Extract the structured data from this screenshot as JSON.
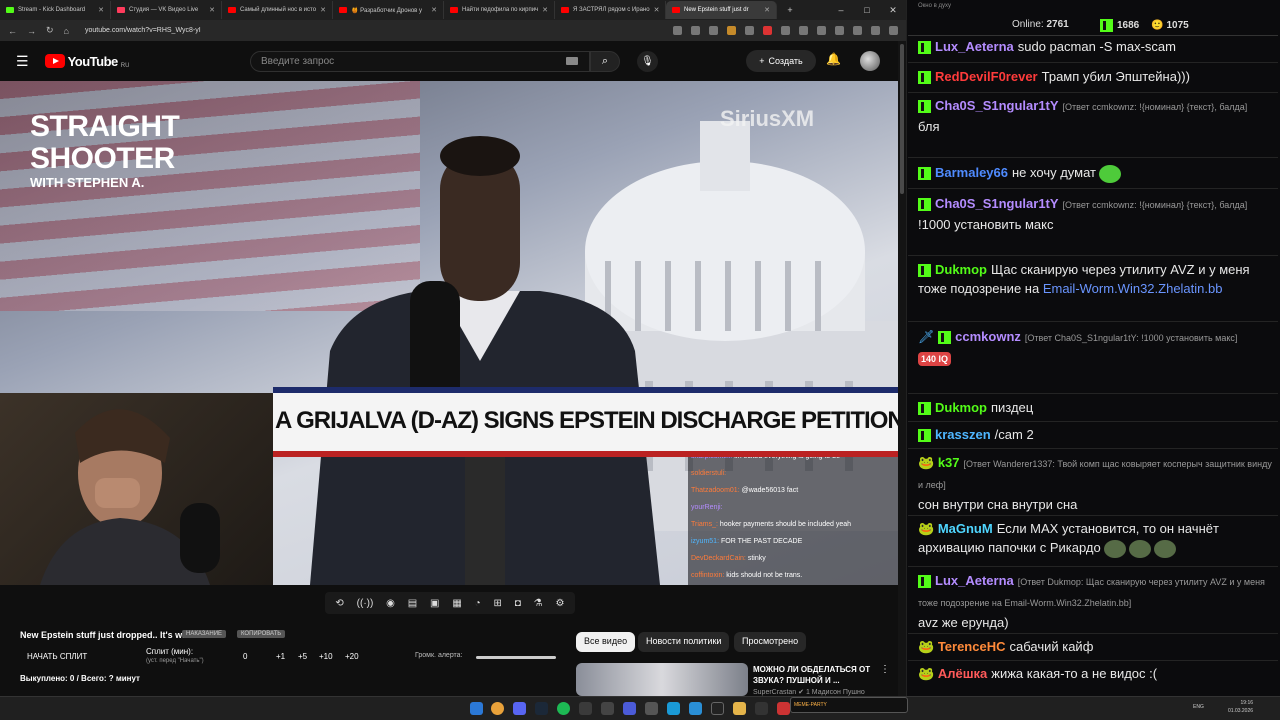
{
  "browser": {
    "tabs": [
      {
        "title": "Stream - Kick Dashboard",
        "color": "#53fc18"
      },
      {
        "title": "Студия — VK Видео Live",
        "color": "#ff3b5c"
      },
      {
        "title": "Самый длинный нос в исто",
        "color": "#ff0000"
      },
      {
        "title": "🍯 Разработчик Дронов у",
        "color": "#ff0000"
      },
      {
        "title": "Найти педофила по кирпич",
        "color": "#ff0000"
      },
      {
        "title": "Я ЗАСТРЯЛ рядом с Ирано",
        "color": "#ff0000"
      },
      {
        "title": "New Epstein stuff just dr",
        "color": "#ff0000"
      }
    ],
    "new_tab": "+",
    "window": {
      "min": "–",
      "max": "□",
      "close": "✕"
    },
    "url": "youtube.com/watch?v=RHS_Wyc8-yI"
  },
  "youtube": {
    "logo_text": "YouTube",
    "region": "RU",
    "search_placeholder": "Введите запрос",
    "create_label": "Создать"
  },
  "video": {
    "brand_line1": "STRAIGHT",
    "brand_line2": "SHOOTER",
    "brand_sub": "WITH STEPHEN A.",
    "watermark": "SiriusXM",
    "banner_text": "A GRIJALVA (D-AZ) SIGNS EPSTEIN DISCHARGE PETITION",
    "overlay_chat": [
      {
        "user": "sharpiesmell:",
        "text": "im ecited everything is going to be",
        "color": "#b48cff"
      },
      {
        "user": "soldierstuli:",
        "text": "",
        "color": "#ff7b3a"
      },
      {
        "user": "Thatzadoom01:",
        "text": "@wade56013 fact",
        "color": "#ff7b3a"
      },
      {
        "user": "yourRenji:",
        "text": "",
        "color": "#b48cff"
      },
      {
        "user": "Triams_:",
        "text": "hooker payments should be included yeah",
        "color": "#ff7b3a"
      },
      {
        "user": "izyum51:",
        "text": "FOR THE PAST DECADE",
        "color": "#4fb6ff"
      },
      {
        "user": "DevDeckardCain:",
        "text": "stinky",
        "color": "#ff7b3a"
      },
      {
        "user": "coffintoxin:",
        "text": "kids should not be trans.",
        "color": "#ff7b3a"
      }
    ]
  },
  "panel": {
    "video_title": "New Epstein stuff just dropped.. It's wild",
    "btn_sample": "НАКАЗАНИЕ",
    "btn_copy": "КОПИРОВАТЬ",
    "start_split": "НАЧАТЬ СПЛИТ",
    "split_min": "Сплит (мин):",
    "split_sub": "(уст. перед \"Начать\")",
    "nums": [
      "0",
      "+1",
      "+5",
      "+10",
      "+20"
    ],
    "alert_label": "Громк. алерта:",
    "alert_level": 1.0,
    "bought": "Выкуплено: 0 / Всего: ? минут"
  },
  "chips": [
    "Все видео",
    "Новости политики",
    "Просмотрено"
  ],
  "recommended": {
    "title": "МОЖНО ЛИ ОБДЕЛАТЬСЯ ОТ ЗВУКА? ПУШНОЙ И ...",
    "channel": "SuperCrastan ✔ 1 Мадисон Пушно"
  },
  "chat": {
    "window_title": "Окно в духу",
    "online_label": "Online:",
    "online": "2761",
    "kick_count": "1686",
    "other_count": "1075",
    "messages": [
      {
        "user": "Lux_Aeterna",
        "color": "#b48cff",
        "reply": "",
        "text": "sudo pacman -S max-scam"
      },
      {
        "user": "RedDevilF0rever",
        "color": "#ff3b3b",
        "reply": "",
        "text": "Трамп убил Эпштейна)))"
      },
      {
        "user": "Cha0S_S1ngular1tY",
        "color": "#b48cff",
        "reply": "[Ответ ccmkownz: !{номинал} {текст}, балда]",
        "text": "бля"
      },
      {
        "user": "Barmaley66",
        "color": "#4f8bff",
        "reply": "",
        "text": "не хочу думат"
      },
      {
        "user": "Cha0S_S1ngular1tY",
        "color": "#b48cff",
        "reply": "[Ответ ccmkownz: !{номинал} {текст}, балда]",
        "text": "!1000 установить макс"
      },
      {
        "user": "Dukmop",
        "color": "#53fc18",
        "reply": "",
        "text": "Щас сканирую через утилиту AVZ и у меня тоже подозрение на ",
        "link": "Email-Worm.Win32.Zhelatin.bb"
      },
      {
        "user": "ccmkownz",
        "color": "#b48cff",
        "reply": "[Ответ Cha0S_S1ngular1tY: !1000 установить макс]",
        "text": "",
        "emote": "140 IQ"
      },
      {
        "user": "Dukmop",
        "color": "#53fc18",
        "reply": "",
        "text": "пиздец"
      },
      {
        "user": "krasszen",
        "color": "#4fb6ff",
        "reply": "",
        "text": "/cam 2"
      },
      {
        "user": "k37",
        "color": "#53fc18",
        "reply": "[Ответ Wanderer1337: Твой комп щас ковыряет косперыч защитник винду и леф]",
        "text": "сон внутри сна внутри сна"
      },
      {
        "user": "MaGnuM",
        "color": "#4fd6ff",
        "reply": "",
        "text": "Если MAX установится, то он начнёт архивацию папочки с Рикардо"
      },
      {
        "user": "Lux_Aeterna",
        "color": "#b48cff",
        "reply": "[Ответ Dukmop: Щас сканирую через утилиту AVZ и у меня тоже подозрение на Email-Worm.Win32.Zhelatin.bb]",
        "text": "avz же ерунда)"
      },
      {
        "user": "TerenceHC",
        "color": "#ff8a3a",
        "reply": "",
        "text": "сабачий кайф"
      },
      {
        "user": "Алёшка",
        "color": "#ff5a5a",
        "reply": "",
        "text": "жижа какая-то а не видос :("
      }
    ]
  },
  "taskbar": {
    "lang": "ENG",
    "time": "19:16",
    "date": "01.03.2026",
    "slider_text": "MEME-PARTY"
  }
}
